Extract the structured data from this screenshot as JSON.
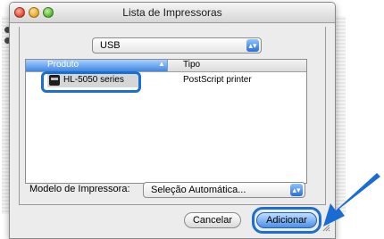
{
  "window": {
    "title": "Lista de Impressoras"
  },
  "connection_popup": {
    "value": "USB",
    "arrow_icon": "popup-arrows-icon"
  },
  "printer_list": {
    "columns": [
      "Produto",
      "Tipo"
    ],
    "rows": [
      {
        "produto": "HL-5050 series",
        "tipo": "PostScript printer"
      }
    ]
  },
  "model": {
    "label": "Modelo de Impressora:",
    "value": "Seleção Automática..."
  },
  "buttons": {
    "cancel": "Cancelar",
    "add": "Adicionar"
  },
  "colors": {
    "highlight": "#1b6fd0",
    "arrow": "#1a6cd4",
    "accent": "#4a90e8"
  }
}
